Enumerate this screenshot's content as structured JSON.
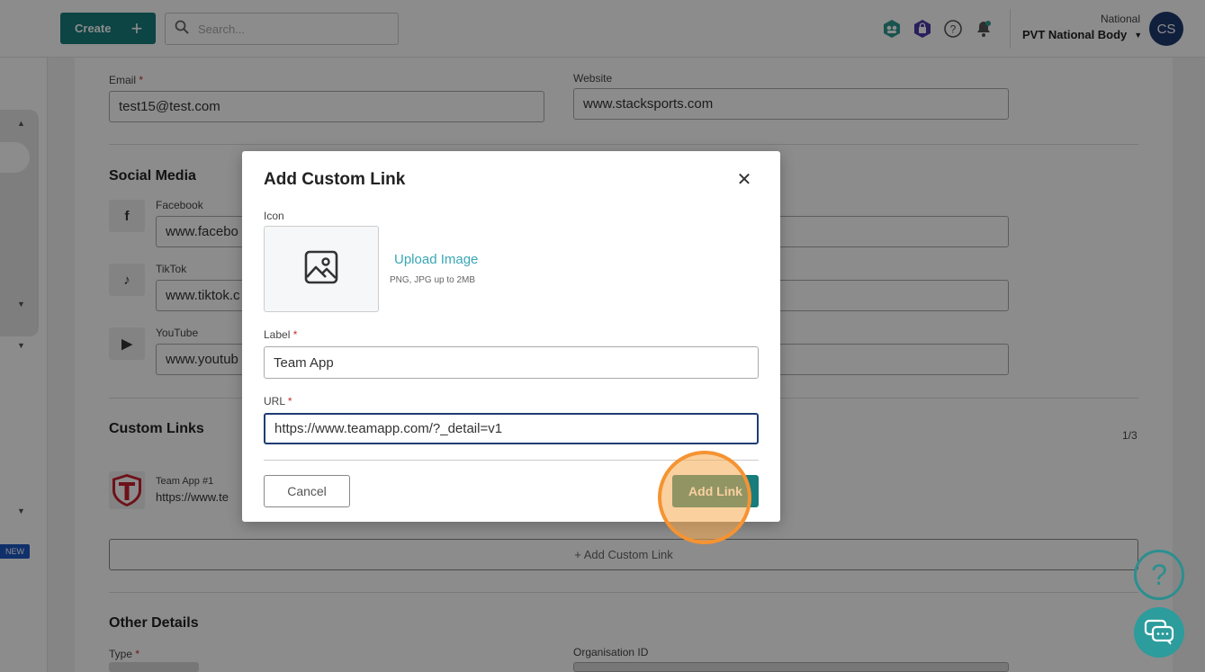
{
  "topbar": {
    "create_label": "Create",
    "search_placeholder": "Search...",
    "org_type": "National",
    "org_name": "PVT National Body",
    "avatar_initials": "CS"
  },
  "sidebar": {
    "new_badge": "NEW"
  },
  "form": {
    "email_label": "Email",
    "email_value": "test15@test.com",
    "website_label": "Website",
    "website_value": "www.stacksports.com",
    "social_title": "Social Media",
    "social": [
      {
        "label": "Facebook",
        "icon_glyph": "f",
        "value": "www.facebo"
      },
      {
        "label": "TikTok",
        "icon_glyph": "♪",
        "value": "www.tiktok.c"
      },
      {
        "label": "YouTube",
        "icon_glyph": "▶",
        "value": "www.youtub"
      }
    ],
    "custom_links_title": "Custom Links",
    "custom_links_count": "1/3",
    "custom_link": {
      "name": "Team App #1",
      "url": "https://www.te"
    },
    "add_custom_link": "+ Add Custom Link",
    "other_title": "Other Details",
    "type_label": "Type",
    "org_id_label": "Organisation ID",
    "required_mark": "*"
  },
  "modal": {
    "title": "Add Custom Link",
    "icon_label": "Icon",
    "upload_label": "Upload Image",
    "upload_hint": "PNG, JPG up to 2MB",
    "label_label": "Label",
    "label_value": "Team App",
    "url_label": "URL",
    "url_value": "https://www.teamapp.com/?_detail=v1",
    "cancel": "Cancel",
    "submit": "Add Link"
  },
  "colors": {
    "primary": "#187c7c",
    "link": "#3aa6b5",
    "avatar": "#1d3a6e",
    "click_highlight": "#f59332"
  }
}
